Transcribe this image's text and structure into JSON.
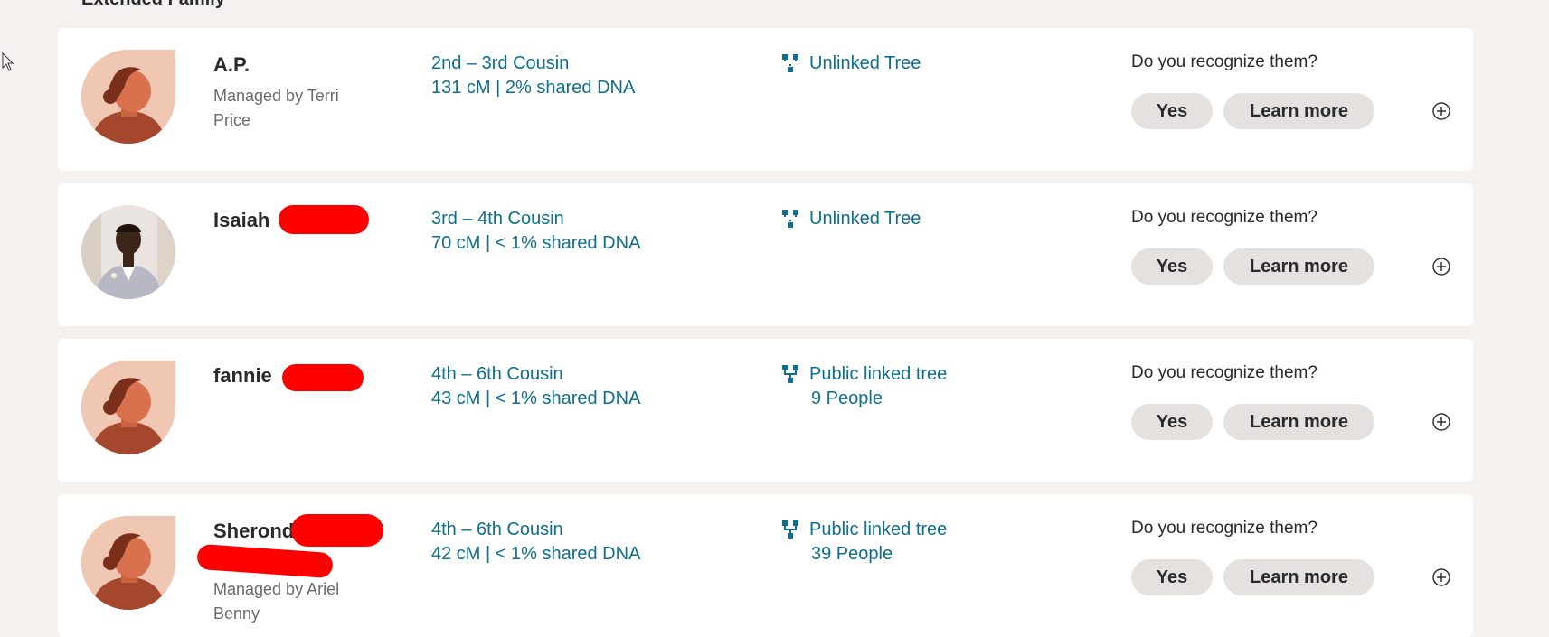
{
  "section": {
    "title": "Extended Family"
  },
  "matches": [
    {
      "name": "A.P.",
      "managed_by": "Managed by Terri Price",
      "relationship": "2nd – 3rd Cousin",
      "dna": "131 cM | 2% shared DNA",
      "tree_label": "Unlinked Tree",
      "tree_count": "",
      "tree_icon": "unlinked-tree-icon",
      "prompt": "Do you recognize them?",
      "yes_label": "Yes",
      "learn_label": "Learn more"
    },
    {
      "name": "Isaiah",
      "managed_by": "",
      "relationship": "3rd – 4th Cousin",
      "dna": "70 cM | < 1% shared DNA",
      "tree_label": "Unlinked Tree",
      "tree_count": "",
      "tree_icon": "unlinked-tree-icon",
      "prompt": "Do you recognize them?",
      "yes_label": "Yes",
      "learn_label": "Learn more"
    },
    {
      "name": "fannie",
      "managed_by": "",
      "relationship": "4th – 6th Cousin",
      "dna": "43 cM | < 1% shared DNA",
      "tree_label": "Public linked tree",
      "tree_count": "9 People",
      "tree_icon": "linked-tree-icon",
      "prompt": "Do you recognize them?",
      "yes_label": "Yes",
      "learn_label": "Learn more"
    },
    {
      "name": "Sherond",
      "managed_by": "Managed by Ariel Benny",
      "relationship": "4th – 6th Cousin",
      "dna": "42 cM | < 1% shared DNA",
      "tree_label": "Public linked tree",
      "tree_count": "39 People",
      "tree_icon": "linked-tree-icon",
      "prompt": "Do you recognize them?",
      "yes_label": "Yes",
      "learn_label": "Learn more"
    }
  ],
  "colors": {
    "accent": "#0d6e8f",
    "background": "#f4f1ee",
    "button": "#e4e1de",
    "redaction": "#ff0000"
  }
}
